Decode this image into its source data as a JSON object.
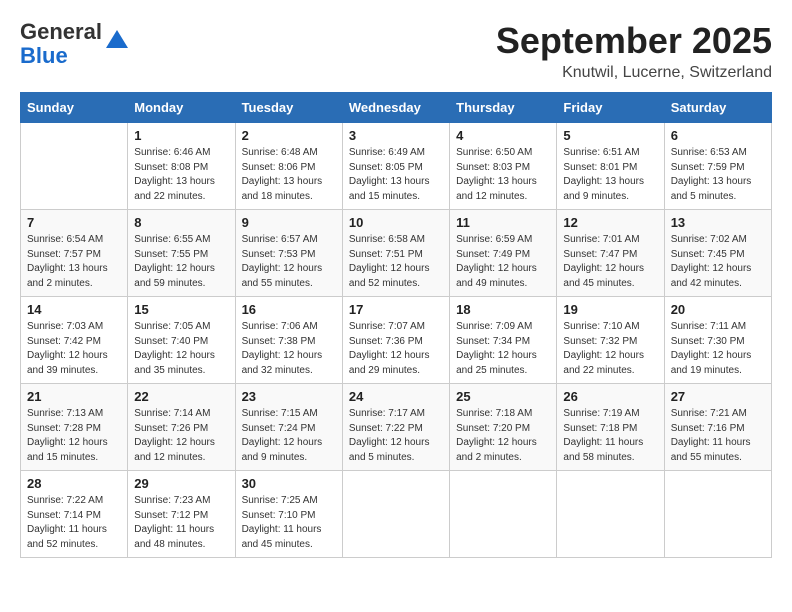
{
  "logo": {
    "general": "General",
    "blue": "Blue"
  },
  "title": "September 2025",
  "subtitle": "Knutwil, Lucerne, Switzerland",
  "weekdays": [
    "Sunday",
    "Monday",
    "Tuesday",
    "Wednesday",
    "Thursday",
    "Friday",
    "Saturday"
  ],
  "weeks": [
    [
      {
        "day": "",
        "info": ""
      },
      {
        "day": "1",
        "info": "Sunrise: 6:46 AM\nSunset: 8:08 PM\nDaylight: 13 hours\nand 22 minutes."
      },
      {
        "day": "2",
        "info": "Sunrise: 6:48 AM\nSunset: 8:06 PM\nDaylight: 13 hours\nand 18 minutes."
      },
      {
        "day": "3",
        "info": "Sunrise: 6:49 AM\nSunset: 8:05 PM\nDaylight: 13 hours\nand 15 minutes."
      },
      {
        "day": "4",
        "info": "Sunrise: 6:50 AM\nSunset: 8:03 PM\nDaylight: 13 hours\nand 12 minutes."
      },
      {
        "day": "5",
        "info": "Sunrise: 6:51 AM\nSunset: 8:01 PM\nDaylight: 13 hours\nand 9 minutes."
      },
      {
        "day": "6",
        "info": "Sunrise: 6:53 AM\nSunset: 7:59 PM\nDaylight: 13 hours\nand 5 minutes."
      }
    ],
    [
      {
        "day": "7",
        "info": "Sunrise: 6:54 AM\nSunset: 7:57 PM\nDaylight: 13 hours\nand 2 minutes."
      },
      {
        "day": "8",
        "info": "Sunrise: 6:55 AM\nSunset: 7:55 PM\nDaylight: 12 hours\nand 59 minutes."
      },
      {
        "day": "9",
        "info": "Sunrise: 6:57 AM\nSunset: 7:53 PM\nDaylight: 12 hours\nand 55 minutes."
      },
      {
        "day": "10",
        "info": "Sunrise: 6:58 AM\nSunset: 7:51 PM\nDaylight: 12 hours\nand 52 minutes."
      },
      {
        "day": "11",
        "info": "Sunrise: 6:59 AM\nSunset: 7:49 PM\nDaylight: 12 hours\nand 49 minutes."
      },
      {
        "day": "12",
        "info": "Sunrise: 7:01 AM\nSunset: 7:47 PM\nDaylight: 12 hours\nand 45 minutes."
      },
      {
        "day": "13",
        "info": "Sunrise: 7:02 AM\nSunset: 7:45 PM\nDaylight: 12 hours\nand 42 minutes."
      }
    ],
    [
      {
        "day": "14",
        "info": "Sunrise: 7:03 AM\nSunset: 7:42 PM\nDaylight: 12 hours\nand 39 minutes."
      },
      {
        "day": "15",
        "info": "Sunrise: 7:05 AM\nSunset: 7:40 PM\nDaylight: 12 hours\nand 35 minutes."
      },
      {
        "day": "16",
        "info": "Sunrise: 7:06 AM\nSunset: 7:38 PM\nDaylight: 12 hours\nand 32 minutes."
      },
      {
        "day": "17",
        "info": "Sunrise: 7:07 AM\nSunset: 7:36 PM\nDaylight: 12 hours\nand 29 minutes."
      },
      {
        "day": "18",
        "info": "Sunrise: 7:09 AM\nSunset: 7:34 PM\nDaylight: 12 hours\nand 25 minutes."
      },
      {
        "day": "19",
        "info": "Sunrise: 7:10 AM\nSunset: 7:32 PM\nDaylight: 12 hours\nand 22 minutes."
      },
      {
        "day": "20",
        "info": "Sunrise: 7:11 AM\nSunset: 7:30 PM\nDaylight: 12 hours\nand 19 minutes."
      }
    ],
    [
      {
        "day": "21",
        "info": "Sunrise: 7:13 AM\nSunset: 7:28 PM\nDaylight: 12 hours\nand 15 minutes."
      },
      {
        "day": "22",
        "info": "Sunrise: 7:14 AM\nSunset: 7:26 PM\nDaylight: 12 hours\nand 12 minutes."
      },
      {
        "day": "23",
        "info": "Sunrise: 7:15 AM\nSunset: 7:24 PM\nDaylight: 12 hours\nand 9 minutes."
      },
      {
        "day": "24",
        "info": "Sunrise: 7:17 AM\nSunset: 7:22 PM\nDaylight: 12 hours\nand 5 minutes."
      },
      {
        "day": "25",
        "info": "Sunrise: 7:18 AM\nSunset: 7:20 PM\nDaylight: 12 hours\nand 2 minutes."
      },
      {
        "day": "26",
        "info": "Sunrise: 7:19 AM\nSunset: 7:18 PM\nDaylight: 11 hours\nand 58 minutes."
      },
      {
        "day": "27",
        "info": "Sunrise: 7:21 AM\nSunset: 7:16 PM\nDaylight: 11 hours\nand 55 minutes."
      }
    ],
    [
      {
        "day": "28",
        "info": "Sunrise: 7:22 AM\nSunset: 7:14 PM\nDaylight: 11 hours\nand 52 minutes."
      },
      {
        "day": "29",
        "info": "Sunrise: 7:23 AM\nSunset: 7:12 PM\nDaylight: 11 hours\nand 48 minutes."
      },
      {
        "day": "30",
        "info": "Sunrise: 7:25 AM\nSunset: 7:10 PM\nDaylight: 11 hours\nand 45 minutes."
      },
      {
        "day": "",
        "info": ""
      },
      {
        "day": "",
        "info": ""
      },
      {
        "day": "",
        "info": ""
      },
      {
        "day": "",
        "info": ""
      }
    ]
  ]
}
